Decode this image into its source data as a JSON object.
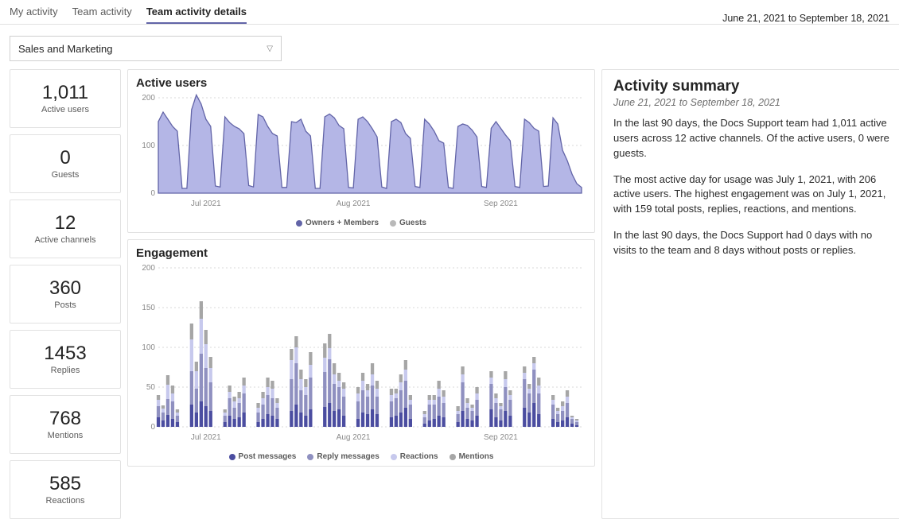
{
  "tabs": {
    "items": [
      "My activity",
      "Team activity",
      "Team activity details"
    ],
    "active": 2
  },
  "date_range": "June 21, 2021 to September 18, 2021",
  "team_select": {
    "value": "Sales and Marketing"
  },
  "metrics": [
    {
      "value": "1,011",
      "label": "Active users"
    },
    {
      "value": "0",
      "label": "Guests"
    },
    {
      "value": "12",
      "label": "Active channels"
    },
    {
      "value": "360",
      "label": "Posts"
    },
    {
      "value": "1453",
      "label": "Replies"
    },
    {
      "value": "768",
      "label": "Mentions"
    },
    {
      "value": "585",
      "label": "Reactions"
    }
  ],
  "active_users": {
    "title": "Active users",
    "legend": [
      "Owners + Members",
      "Guests"
    ]
  },
  "engagement": {
    "title": "Engagement",
    "legend": [
      "Post messages",
      "Reply messages",
      "Reactions",
      "Mentions"
    ]
  },
  "x_ticks": [
    "Jul 2021",
    "Aug 2021",
    "Sep 2021"
  ],
  "summary": {
    "heading": "Activity summary",
    "subtitle": "June 21, 2021 to September 18, 2021",
    "p1": "In the last 90 days, the Docs Support team had 1,011 active users across 12 active channels. Of the active users, 0 were guests.",
    "p2": "The most active day for usage was July 1, 2021, with 206 active users. The highest engagement was on July 1, 2021, with 159 total posts, replies, reactions, and mentions.",
    "p3": "In the last 90 days, the Docs Support had 0 days with no visits to the team and 8 days without posts or replies."
  },
  "chart_data": [
    {
      "type": "area",
      "title": "Active users",
      "ylim": [
        0,
        200
      ],
      "yticks": [
        0,
        100,
        200
      ],
      "xlabel": "",
      "ylabel": "",
      "categories": [
        "Jul 2021",
        "Aug 2021",
        "Sep 2021"
      ],
      "series": [
        {
          "name": "Owners + Members",
          "values": [
            150,
            170,
            155,
            140,
            130,
            10,
            10,
            175,
            206,
            187,
            155,
            140,
            15,
            13,
            160,
            148,
            140,
            135,
            125,
            16,
            13,
            165,
            160,
            140,
            125,
            120,
            12,
            12,
            150,
            148,
            155,
            130,
            120,
            10,
            10,
            160,
            166,
            158,
            142,
            135,
            12,
            11,
            155,
            160,
            150,
            135,
            118,
            13,
            10,
            150,
            155,
            148,
            125,
            115,
            14,
            12,
            155,
            145,
            130,
            110,
            105,
            12,
            10,
            140,
            145,
            142,
            132,
            118,
            14,
            12,
            136,
            150,
            136,
            122,
            110,
            14,
            12,
            155,
            148,
            136,
            130,
            14,
            15,
            158,
            145,
            90,
            68,
            40,
            20,
            12
          ]
        },
        {
          "name": "Guests",
          "values": [
            0,
            0,
            0,
            0,
            0,
            0,
            0,
            0,
            0,
            0,
            0,
            0,
            0,
            0,
            0,
            0,
            0,
            0,
            0,
            0,
            0,
            0,
            0,
            0,
            0,
            0,
            0,
            0,
            0,
            0,
            0,
            0,
            0,
            0,
            0,
            0,
            0,
            0,
            0,
            0,
            0,
            0,
            0,
            0,
            0,
            0,
            0,
            0,
            0,
            0,
            0,
            0,
            0,
            0,
            0,
            0,
            0,
            0,
            0,
            0,
            0,
            0,
            0,
            0,
            0,
            0,
            0,
            0,
            0,
            0,
            0,
            0,
            0,
            0,
            0,
            0,
            0,
            0,
            0,
            0,
            0,
            0,
            0,
            0,
            0,
            0,
            0,
            0,
            0,
            0
          ]
        }
      ]
    },
    {
      "type": "bar",
      "title": "Engagement",
      "ylim": [
        0,
        200
      ],
      "yticks": [
        0,
        50,
        100,
        150,
        200
      ],
      "xlabel": "",
      "ylabel": "",
      "categories": [
        "Jul 2021",
        "Aug 2021",
        "Sep 2021"
      ],
      "series": [
        {
          "name": "Post messages",
          "values": [
            12,
            8,
            15,
            10,
            6,
            0,
            0,
            28,
            18,
            32,
            26,
            20,
            0,
            0,
            6,
            14,
            10,
            12,
            18,
            0,
            0,
            6,
            10,
            16,
            14,
            10,
            0,
            0,
            20,
            28,
            18,
            14,
            22,
            0,
            0,
            25,
            30,
            20,
            22,
            14,
            0,
            0,
            10,
            18,
            16,
            22,
            16,
            0,
            0,
            12,
            14,
            18,
            24,
            10,
            0,
            0,
            4,
            8,
            10,
            14,
            12,
            0,
            0,
            6,
            20,
            10,
            8,
            14,
            0,
            0,
            22,
            12,
            8,
            20,
            14,
            0,
            0,
            24,
            18,
            30,
            16,
            0,
            0,
            10,
            6,
            8,
            12,
            4,
            2,
            0
          ]
        },
        {
          "name": "Reply messages",
          "values": [
            14,
            10,
            20,
            22,
            8,
            0,
            0,
            42,
            30,
            60,
            48,
            36,
            0,
            0,
            8,
            22,
            14,
            18,
            24,
            0,
            0,
            12,
            18,
            24,
            22,
            14,
            0,
            0,
            40,
            52,
            28,
            26,
            40,
            0,
            0,
            44,
            55,
            34,
            28,
            24,
            0,
            0,
            22,
            28,
            22,
            30,
            22,
            0,
            0,
            20,
            22,
            28,
            34,
            18,
            0,
            0,
            8,
            20,
            18,
            24,
            18,
            0,
            0,
            10,
            36,
            14,
            12,
            20,
            0,
            0,
            32,
            18,
            14,
            30,
            20,
            0,
            0,
            36,
            24,
            42,
            26,
            0,
            0,
            18,
            10,
            12,
            18,
            6,
            4,
            0
          ]
        },
        {
          "name": "Reactions",
          "values": [
            8,
            5,
            18,
            10,
            4,
            0,
            0,
            40,
            22,
            44,
            30,
            18,
            0,
            0,
            4,
            8,
            8,
            6,
            10,
            0,
            0,
            6,
            8,
            10,
            12,
            6,
            0,
            0,
            24,
            20,
            14,
            10,
            16,
            0,
            0,
            18,
            14,
            12,
            8,
            10,
            0,
            0,
            10,
            12,
            8,
            14,
            10,
            0,
            0,
            8,
            6,
            10,
            14,
            6,
            0,
            0,
            4,
            6,
            6,
            10,
            8,
            0,
            0,
            4,
            10,
            6,
            4,
            8,
            0,
            0,
            8,
            6,
            4,
            10,
            6,
            0,
            0,
            8,
            6,
            8,
            10,
            0,
            0,
            6,
            4,
            6,
            8,
            2,
            2,
            0
          ]
        },
        {
          "name": "Mentions",
          "values": [
            6,
            4,
            12,
            10,
            4,
            0,
            0,
            20,
            12,
            22,
            18,
            14,
            0,
            0,
            4,
            8,
            6,
            8,
            10,
            0,
            0,
            6,
            8,
            12,
            10,
            6,
            0,
            0,
            14,
            14,
            12,
            10,
            16,
            0,
            0,
            18,
            18,
            14,
            10,
            8,
            0,
            0,
            8,
            10,
            8,
            14,
            10,
            0,
            0,
            8,
            6,
            10,
            12,
            6,
            0,
            0,
            4,
            6,
            6,
            10,
            8,
            0,
            0,
            6,
            10,
            6,
            4,
            8,
            0,
            0,
            8,
            6,
            4,
            10,
            6,
            0,
            0,
            8,
            6,
            8,
            10,
            0,
            0,
            6,
            4,
            6,
            8,
            2,
            2,
            0
          ]
        }
      ]
    }
  ]
}
